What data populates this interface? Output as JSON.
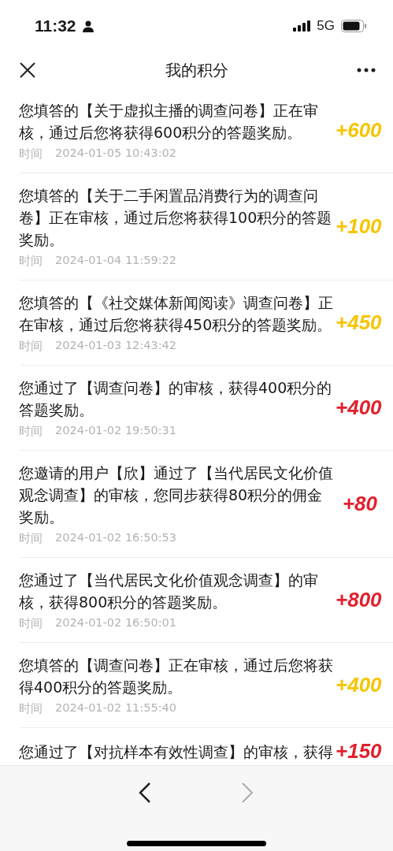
{
  "status_bar": {
    "time": "11:32",
    "network": "5G"
  },
  "nav": {
    "title": "我的积分"
  },
  "records": [
    {
      "text": "您填答的【关于虚拟主播的调查问卷】正在审核，通过后您将获得600积分的答题奖励。",
      "time_label": "时间",
      "time": "2024-01-05 10:43:02",
      "points": "+600",
      "kind": "pending"
    },
    {
      "text": "您填答的【关于二手闲置品消费行为的调查问卷】正在审核，通过后您将获得100积分的答题奖励。",
      "time_label": "时间",
      "time": "2024-01-04 11:59:22",
      "points": "+100",
      "kind": "pending"
    },
    {
      "text": "您填答的【《社交媒体新闻阅读》调查问卷】正在审核，通过后您将获得450积分的答题奖励。",
      "time_label": "时间",
      "time": "2024-01-03 12:43:42",
      "points": "+450",
      "kind": "pending"
    },
    {
      "text": "您通过了【调查问卷】的审核，获得400积分的答题奖励。",
      "time_label": "时间",
      "time": "2024-01-02 19:50:31",
      "points": "+400",
      "kind": "approved"
    },
    {
      "text": "您邀请的用户【欣】通过了【当代居民文化价值观念调查】的审核，您同步获得80积分的佣金奖励。",
      "time_label": "时间",
      "time": "2024-01-02 16:50:53",
      "points": "+80",
      "kind": "approved"
    },
    {
      "text": "您通过了【当代居民文化价值观念调查】的审核，获得800积分的答题奖励。",
      "time_label": "时间",
      "time": "2024-01-02 16:50:01",
      "points": "+800",
      "kind": "approved"
    },
    {
      "text": "您填答的【调查问卷】正在审核，通过后您将获得400积分的答题奖励。",
      "time_label": "时间",
      "time": "2024-01-02 11:55:40",
      "points": "+400",
      "kind": "pending"
    },
    {
      "text": "您通过了【对抗样本有效性调查】的审核，获得",
      "points": "+150",
      "kind": "approved"
    }
  ]
}
